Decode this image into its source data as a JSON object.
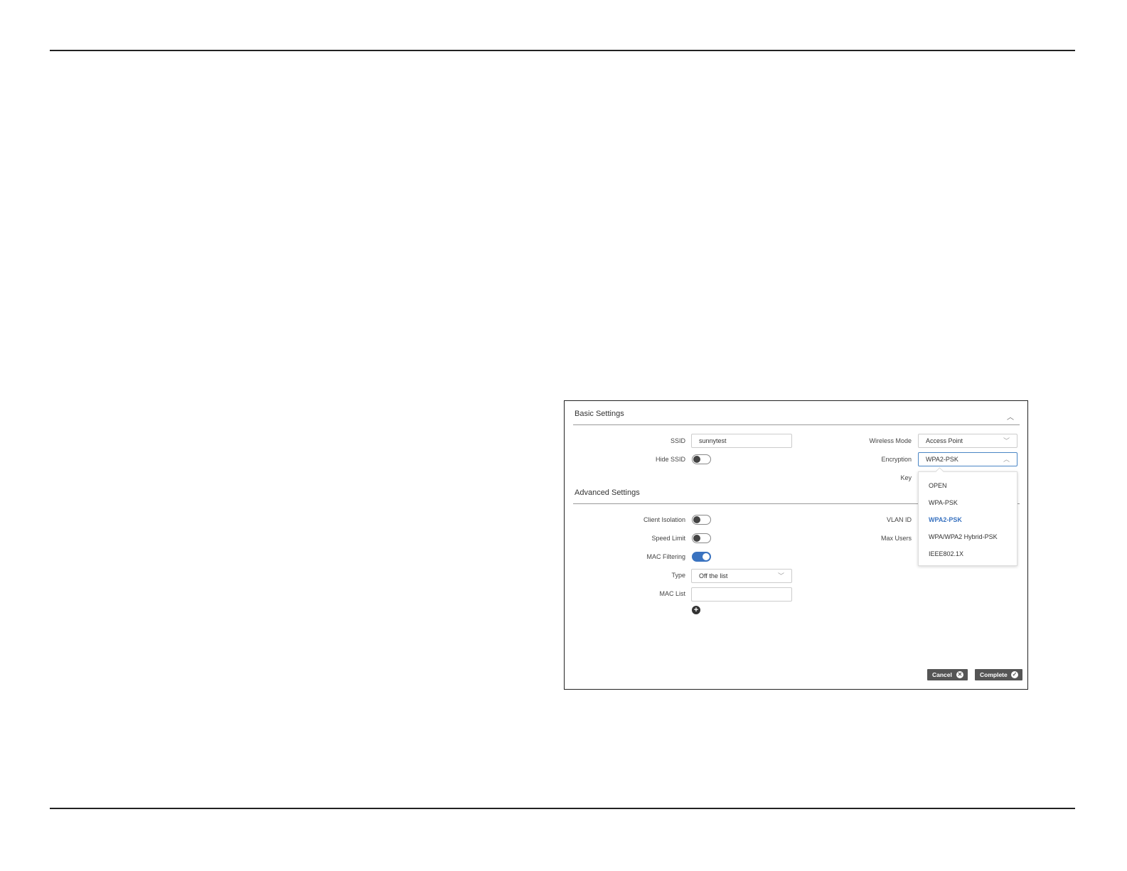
{
  "basic": {
    "title": "Basic Settings",
    "ssid_label": "SSID",
    "ssid_value": "sunnytest",
    "hide_ssid_label": "Hide SSID",
    "wireless_mode_label": "Wireless Mode",
    "wireless_mode_value": "Access Point",
    "encryption_label": "Encryption",
    "encryption_value": "WPA2-PSK",
    "key_label": "Key"
  },
  "advanced": {
    "title": "Advanced Settings",
    "client_isolation_label": "Client Isolation",
    "speed_limit_label": "Speed Limit",
    "mac_filtering_label": "MAC Filtering",
    "type_label": "Type",
    "type_value": "Off the list",
    "mac_list_label": "MAC List",
    "vlan_id_label": "VLAN ID",
    "max_users_label": "Max Users"
  },
  "encryption_options": [
    "OPEN",
    "WPA-PSK",
    "WPA2-PSK",
    "WPA/WPA2 Hybrid-PSK",
    "IEEE802.1X"
  ],
  "buttons": {
    "cancel": "Cancel",
    "complete": "Complete"
  },
  "colors": {
    "accent": "#3a73c0",
    "button": "#555555"
  }
}
